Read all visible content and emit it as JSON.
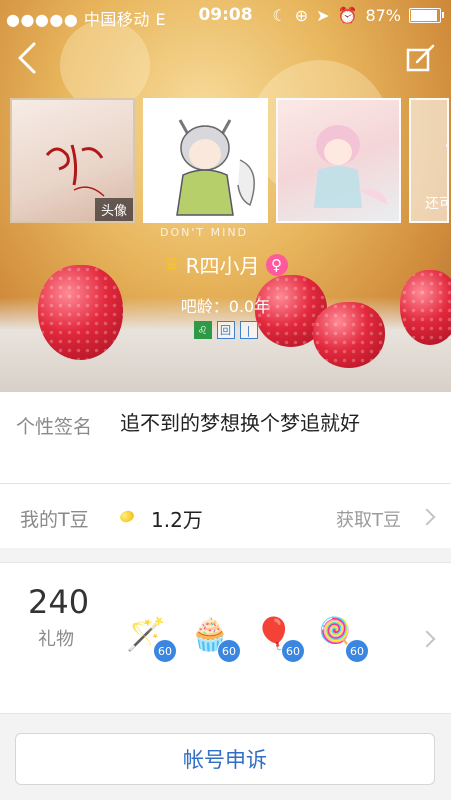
{
  "status_bar": {
    "signal": "●●●●● 中国移动 E",
    "time": "09:08",
    "battery": "87%"
  },
  "profile": {
    "avatar_badge": "头像",
    "more_label": "还可",
    "photo_caption": "DON'T MIND",
    "username": "R四小月",
    "ba_age": "吧龄：0.0年",
    "tags": [
      "♌",
      "回",
      "|"
    ]
  },
  "signature": {
    "label": "个性签名",
    "value": "追不到的梦想换个梦追就好"
  },
  "tdou": {
    "label": "我的T豆",
    "amount": "1.2万",
    "get_label": "获取T豆"
  },
  "gifts": {
    "count": "240",
    "label": "礼物",
    "items": [
      {
        "icon": "magic-wand-icon",
        "glyph": "🪄",
        "count": "60"
      },
      {
        "icon": "cupcake-icon",
        "glyph": "🧁",
        "count": "60"
      },
      {
        "icon": "balloons-icon",
        "glyph": "🎈",
        "count": "60"
      },
      {
        "icon": "lollipop-icon",
        "glyph": "🍭",
        "count": "60"
      }
    ]
  },
  "appeal_button": "帐号申诉",
  "colors": {
    "accent_blue": "#2f6fc4",
    "badge_blue": "#3a86e0",
    "female_pink": "#ff5a9c"
  }
}
